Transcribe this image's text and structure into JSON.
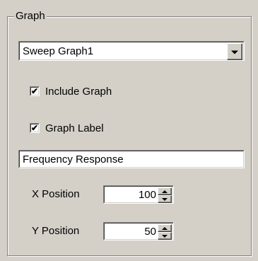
{
  "group": {
    "title": "Graph"
  },
  "graph_select": {
    "value": "Sweep Graph1",
    "icon": "chevron-down-icon"
  },
  "include_graph": {
    "label": "Include Graph",
    "checked": true
  },
  "graph_label": {
    "label": "Graph Label",
    "checked": true
  },
  "label_text": {
    "value": "Frequency Response"
  },
  "x_position": {
    "label": "X Position",
    "value": "100"
  },
  "y_position": {
    "label": "Y Position",
    "value": "50"
  }
}
